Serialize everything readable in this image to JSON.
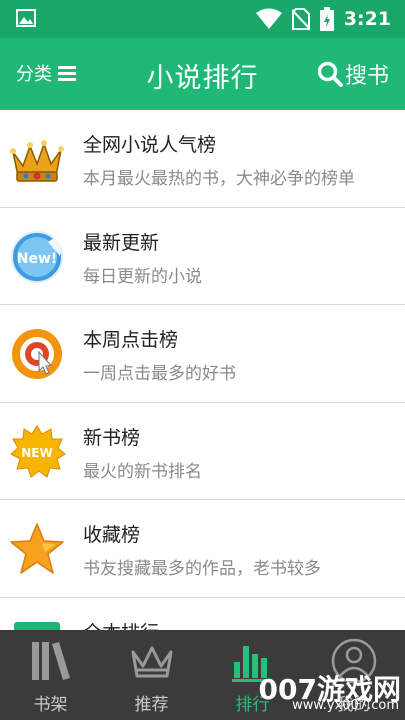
{
  "status_bar": {
    "time": "3:21"
  },
  "header": {
    "category_label": "分类",
    "title": "小说排行",
    "search_label": "搜书",
    "accent_color": "#1fb877"
  },
  "rankings": [
    {
      "title": "全网小说人气榜",
      "subtitle": "本月最火最热的书，大神必争的榜单",
      "icon": "crown-icon"
    },
    {
      "title": "最新更新",
      "subtitle": "每日更新的小说",
      "icon": "new-sticker-icon"
    },
    {
      "title": "本周点击榜",
      "subtitle": "一周点击最多的好书",
      "icon": "click-target-icon"
    },
    {
      "title": "新书榜",
      "subtitle": "最火的新书排名",
      "icon": "new-badge-icon"
    },
    {
      "title": "收藏榜",
      "subtitle": "书友搜藏最多的作品，老书较多",
      "icon": "star-icon"
    },
    {
      "title": "全本排行",
      "subtitle": "",
      "icon": "complete-book-icon"
    }
  ],
  "badges": {
    "new_sticker": "New!",
    "new_badge": "NEW"
  },
  "bottom_nav": [
    {
      "label": "书架",
      "icon": "bookshelf-icon",
      "active": false
    },
    {
      "label": "推荐",
      "icon": "crown-outline-icon",
      "active": false
    },
    {
      "label": "排行",
      "icon": "bar-chart-icon",
      "active": true
    },
    {
      "label": "我的",
      "icon": "user-icon",
      "active": false
    }
  ],
  "watermark": {
    "text": "007游戏网",
    "url": "www.yx007.com"
  }
}
